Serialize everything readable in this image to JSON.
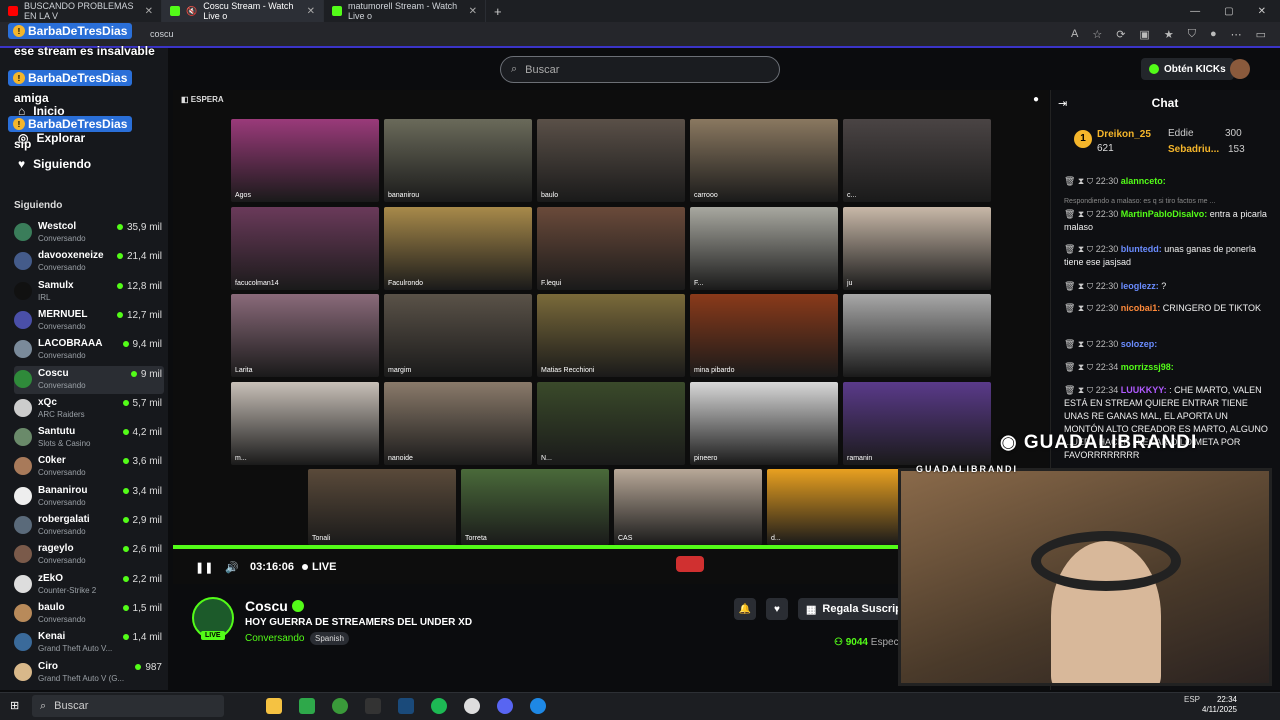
{
  "browser": {
    "tabs": [
      {
        "label": "BUSCANDO PROBLEMAS EN LA V",
        "color": "#ff0000"
      },
      {
        "label": "Coscu Stream - Watch Live o",
        "color": "#53fc18"
      },
      {
        "label": "matumorell Stream - Watch Live o",
        "color": "#53fc18"
      }
    ],
    "url": "coscu",
    "window_controls": [
      "—",
      "▢",
      "✕"
    ]
  },
  "chat_overlay": {
    "user": "BarbaDeTresDias",
    "messages": [
      "ese stream es insalvable",
      "amiga",
      "sip"
    ]
  },
  "nav": {
    "items": [
      "Inicio",
      "Explorar",
      "Siguiendo"
    ],
    "section_label": "Siguiendo"
  },
  "channels": [
    {
      "name": "Westcol",
      "status": "Conversando",
      "viewers": "35,9 mil",
      "color": "#3a7d5a"
    },
    {
      "name": "davooxeneize",
      "status": "Conversando",
      "viewers": "21,4 mil",
      "color": "#445b8a"
    },
    {
      "name": "Samulx",
      "status": "IRL",
      "viewers": "12,8 mil",
      "color": "#111111"
    },
    {
      "name": "MERNUEL",
      "status": "Conversando",
      "viewers": "12,7 mil",
      "color": "#4a4fa8"
    },
    {
      "name": "LACOBRAAA",
      "status": "Conversando",
      "viewers": "9,4 mil",
      "color": "#7a8a9a"
    },
    {
      "name": "Coscu",
      "status": "Conversando",
      "viewers": "9 mil",
      "color": "#2f8a3a"
    },
    {
      "name": "xQc",
      "status": "ARC Raiders",
      "viewers": "5,7 mil",
      "color": "#cccccc"
    },
    {
      "name": "Santutu",
      "status": "Slots & Casino",
      "viewers": "4,2 mil",
      "color": "#6a8a6a"
    },
    {
      "name": "C0ker",
      "status": "Conversando",
      "viewers": "3,6 mil",
      "color": "#a87a5a"
    },
    {
      "name": "Bananirou",
      "status": "Conversando",
      "viewers": "3,4 mil",
      "color": "#eeeeee"
    },
    {
      "name": "robergalati",
      "status": "Conversando",
      "viewers": "2,9 mil",
      "color": "#5a6a7a"
    },
    {
      "name": "rageylo",
      "status": "Conversando",
      "viewers": "2,6 mil",
      "color": "#7a5a4a"
    },
    {
      "name": "zEkO",
      "status": "Counter-Strike 2",
      "viewers": "2,2 mil",
      "color": "#dddddd"
    },
    {
      "name": "baulo",
      "status": "Conversando",
      "viewers": "1,5 mil",
      "color": "#b88a5a"
    },
    {
      "name": "Kenai",
      "status": "Grand Theft Auto V...",
      "viewers": "1,4 mil",
      "color": "#3a6a9a"
    },
    {
      "name": "Ciro",
      "status": "Grand Theft Auto V (G...",
      "viewers": "987",
      "color": "#d8b88a"
    }
  ],
  "search": {
    "placeholder": "Buscar"
  },
  "header": {
    "kicks_label": "Obtén KICKs"
  },
  "player": {
    "status_label": "ESPERA",
    "time": "03:16:06",
    "live_label": "LIVE",
    "tiles": [
      {
        "label": "Agos",
        "color": "#9a3a7a"
      },
      {
        "label": "bananirou",
        "color": "#6a6a5a"
      },
      {
        "label": "baulo",
        "color": "#5a5048"
      },
      {
        "label": "carrooo",
        "color": "#8a7860"
      },
      {
        "label": "c...",
        "color": "#4a4444"
      },
      {
        "label": "facucolman14",
        "color": "#6a3a5a"
      },
      {
        "label": "Faculrondo",
        "color": "#a88a4a"
      },
      {
        "label": "F.lequi",
        "color": "#6a4a3a"
      },
      {
        "label": "F...",
        "color": "#a8a8a0"
      },
      {
        "label": "ju",
        "color": "#c8b8a8"
      },
      {
        "label": "Larita",
        "color": "#8a6a7a"
      },
      {
        "label": "margim",
        "color": "#5a5248"
      },
      {
        "label": "Matias Recchioni",
        "color": "#7a6a3a"
      },
      {
        "label": "mina pibardo",
        "color": "#8a3a1a"
      },
      {
        "label": "",
        "color": "#a8a8a8"
      },
      {
        "label": "m...",
        "color": "#c8c0b8"
      },
      {
        "label": "nanoide",
        "color": "#8a7a6a"
      },
      {
        "label": "N...",
        "color": "#3a4a2a"
      },
      {
        "label": "pineero",
        "color": "#d8d8d8"
      },
      {
        "label": "ramanin",
        "color": "#5a3a8a"
      },
      {
        "label": "Tonali",
        "color": "#5a4a3a"
      },
      {
        "label": "Torreta",
        "color": "#4a6a3a"
      },
      {
        "label": "CAS",
        "color": "#b8a898"
      },
      {
        "label": "d...",
        "color": "#e8a020"
      }
    ]
  },
  "stream": {
    "name": "Coscu",
    "live_badge": "LIVE",
    "title": "HOY GUERRA DE STREAMERS DEL UNDER XD",
    "category": "Conversando",
    "language": "Spanish",
    "gift_label": "Regala Suscripc",
    "viewers": "9044",
    "viewers_suffix": "Espec"
  },
  "chat": {
    "title": "Chat",
    "leaderboard": [
      {
        "rank": "1",
        "name": "Dreikon_25",
        "count": "621"
      },
      {
        "name": "Eddie",
        "count": "300"
      },
      {
        "name": "Sebadriu...",
        "count": "153"
      }
    ],
    "reply_note": "Respondiendo a malaso: es q si tiro factos me ...",
    "messages": [
      {
        "time": "22:30",
        "user": "alannceto:",
        "text": "",
        "color": "#53fc18"
      },
      {
        "time": "22:30",
        "user": "MartinPabloDisalvo:",
        "text": "entra a picarla malaso",
        "color": "#53fc18"
      },
      {
        "time": "22:30",
        "user": "bluntedd:",
        "text": "unas ganas de ponerla tiene ese jasjsad",
        "color": "#6a8cff"
      },
      {
        "time": "22:30",
        "user": "leoglezz:",
        "text": "?",
        "color": "#6a8cff"
      },
      {
        "time": "22:30",
        "user": "nicobai1:",
        "text": "CRINGERO DE TIKTOK",
        "color": "#ff8a3a"
      },
      {
        "time": "22:30",
        "user": "solozep:",
        "text": "",
        "color": "#6a8cff"
      },
      {
        "time": "22:34",
        "user": "morrizssj98:",
        "text": "",
        "color": "#53fc18"
      },
      {
        "time": "22:34",
        "user": "LUUKKYY:",
        "text": ": CHE MARTO, VALEN ESTÁ EN STREAM QUIERE ENTRAR TIENE UNAS RE GANAS MAL, EL APORTA UN MONTÓN ALTO CREADOR ES MARTO, ALGUNO ...UEDA HACER LLEGAR O LO META POR FAVORRRRRRRR",
        "color": "#b05aff"
      }
    ]
  },
  "streamer_overlay": {
    "instagram": "GUADALIBRANDI",
    "cam_label": "GUADALIBRANDI"
  },
  "taskbar": {
    "search": "Buscar",
    "lang": "ESP",
    "time": "22:34",
    "date": "4/11/2025"
  }
}
